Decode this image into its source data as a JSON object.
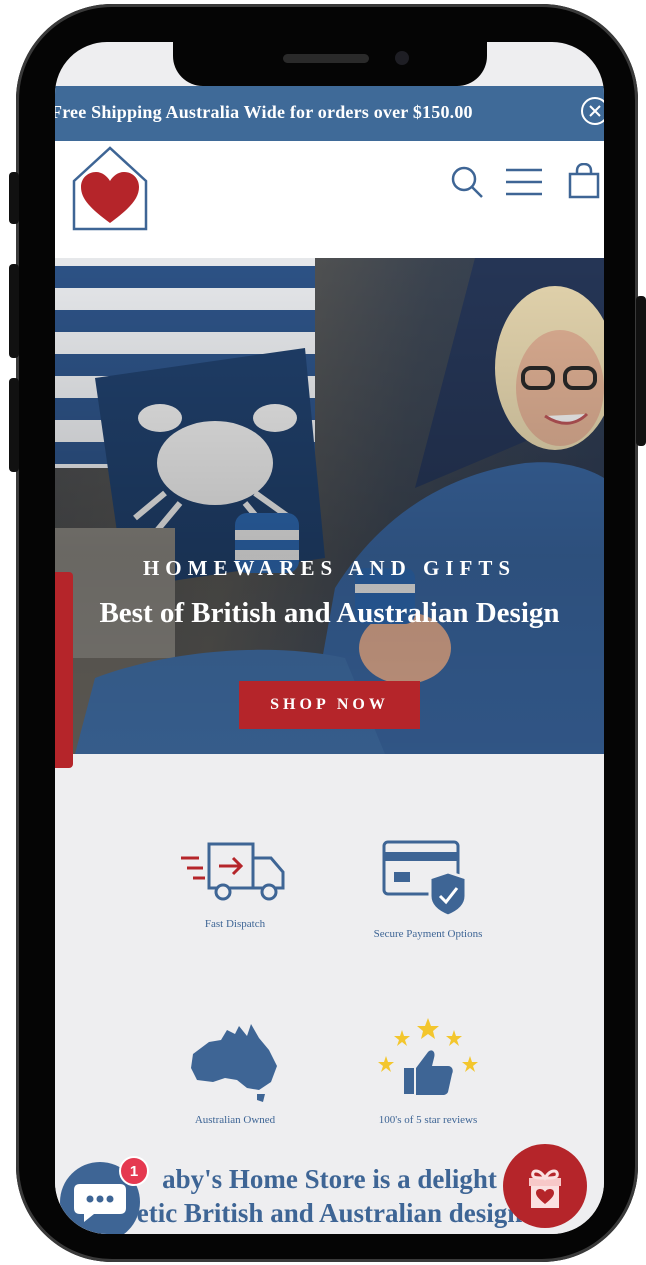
{
  "colors": {
    "brand_blue": "#3e6595",
    "brand_red": "#b5252a",
    "announce_bg": "#3f6a98",
    "badge_red": "#e53950"
  },
  "announcement": {
    "text": "Free Shipping Australia Wide for orders over $150.00",
    "close_icon": "close-icon"
  },
  "header": {
    "logo_icon": "house-heart-logo",
    "search_icon": "search-icon",
    "menu_icon": "hamburger-menu-icon",
    "cart_icon": "shopping-bag-icon"
  },
  "hero": {
    "eyebrow": "HOMEWARES AND GIFTS",
    "title": "Best of British and Australian Design",
    "cta_label": "SHOP NOW"
  },
  "features": [
    {
      "label": "Fast Dispatch",
      "icon": "delivery-truck-icon"
    },
    {
      "label": "Secure Payment Options",
      "icon": "credit-card-shield-icon"
    },
    {
      "label": "Australian Owned",
      "icon": "australia-map-icon"
    },
    {
      "label": "100's of 5 star reviews",
      "icon": "thumbs-up-stars-icon"
    }
  ],
  "about": {
    "line1": "aby's Home Store is a delight",
    "line2": "etic British and Australian design"
  },
  "chat": {
    "icon": "chat-bubble-icon",
    "badge_count": "1"
  },
  "gift": {
    "icon": "gift-icon"
  }
}
